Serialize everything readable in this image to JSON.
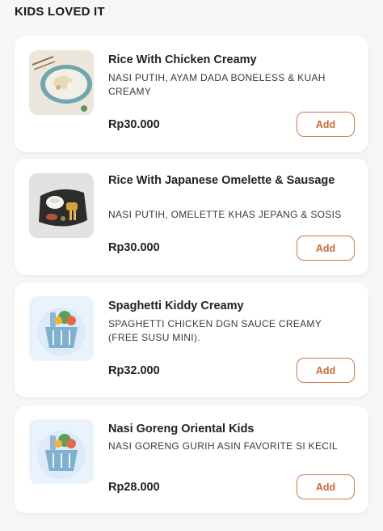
{
  "section": {
    "title": "KIDS LOVED IT"
  },
  "items": [
    {
      "name": "Rice With Chicken Creamy",
      "description": "NASI PUTIH, AYAM DADA BONELESS & KUAH CREAMY",
      "price": "Rp30.000",
      "add_label": "Add",
      "image_icon": "creamy-chicken-rice-plate-icon"
    },
    {
      "name": "Rice With Japanese Omelette & Sausage",
      "description": "NASI PUTIH, OMELETTE KHAS JEPANG & SOSIS",
      "price": "Rp30.000",
      "add_label": "Add",
      "image_icon": "bento-plate-icon"
    },
    {
      "name": "Spaghetti Kiddy Creamy",
      "description": "SPAGHETTI CHICKEN DGN SAUCE CREAMY (FREE SUSU MINI).",
      "price": "Rp32.000",
      "add_label": "Add",
      "image_icon": "grocery-basket-icon"
    },
    {
      "name": "Nasi Goreng Oriental Kids",
      "description": "NASI GORENG GURIH ASIN FAVORITE SI KECIL",
      "price": "Rp28.000",
      "add_label": "Add",
      "image_icon": "grocery-basket-icon"
    }
  ],
  "colors": {
    "accent": "#c46a3c",
    "card_bg": "#ffffff",
    "page_bg": "#f6f6f8"
  }
}
